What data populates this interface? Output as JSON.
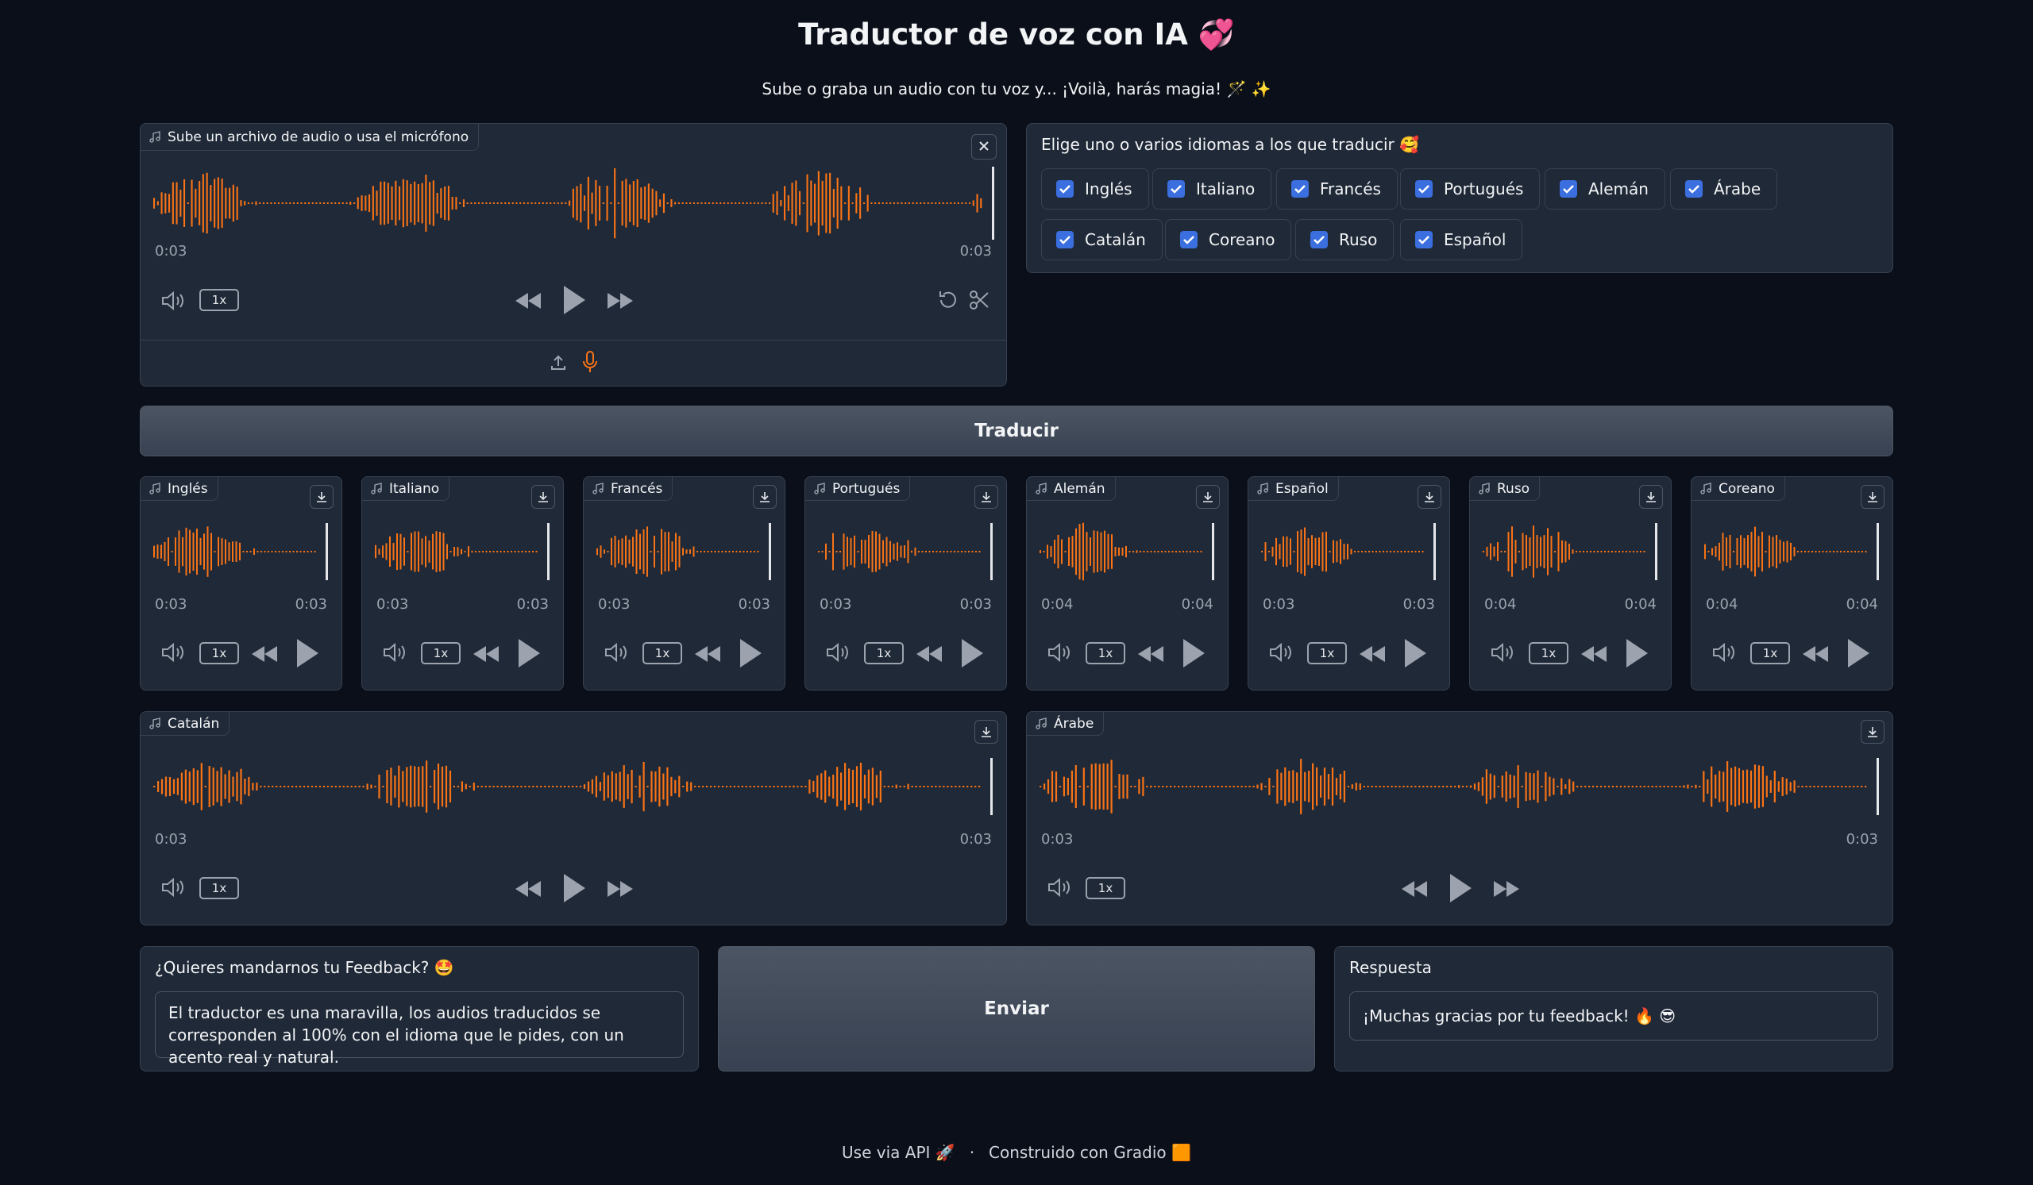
{
  "header": {
    "title": "Traductor de voz con IA 💞",
    "subtitle": "Sube o graba un audio con tu voz y... ¡Voilà, harás magia! 🪄 ✨"
  },
  "input_audio": {
    "label": "Sube un archivo de audio o usa el micrófono",
    "time_current": "0:03",
    "time_total": "0:03",
    "speed": "1x"
  },
  "languages": {
    "label": "Elige uno o varios idiomas a los que traducir 🥰",
    "options": [
      {
        "label": "Inglés",
        "checked": true
      },
      {
        "label": "Italiano",
        "checked": true
      },
      {
        "label": "Francés",
        "checked": true
      },
      {
        "label": "Portugués",
        "checked": true
      },
      {
        "label": "Alemán",
        "checked": true
      },
      {
        "label": "Árabe",
        "checked": true
      },
      {
        "label": "Catalán",
        "checked": true
      },
      {
        "label": "Coreano",
        "checked": true
      },
      {
        "label": "Ruso",
        "checked": true
      },
      {
        "label": "Español",
        "checked": true
      }
    ]
  },
  "translate_button": "Traducir",
  "outputs": [
    {
      "label": "Inglés",
      "time_current": "0:03",
      "time_total": "0:03",
      "speed": "1x"
    },
    {
      "label": "Italiano",
      "time_current": "0:03",
      "time_total": "0:03",
      "speed": "1x"
    },
    {
      "label": "Francés",
      "time_current": "0:03",
      "time_total": "0:03",
      "speed": "1x"
    },
    {
      "label": "Portugués",
      "time_current": "0:03",
      "time_total": "0:03",
      "speed": "1x"
    },
    {
      "label": "Alemán",
      "time_current": "0:04",
      "time_total": "0:04",
      "speed": "1x"
    },
    {
      "label": "Español",
      "time_current": "0:03",
      "time_total": "0:03",
      "speed": "1x"
    },
    {
      "label": "Ruso",
      "time_current": "0:04",
      "time_total": "0:04",
      "speed": "1x"
    },
    {
      "label": "Coreano",
      "time_current": "0:04",
      "time_total": "0:04",
      "speed": "1x"
    }
  ],
  "wide_outputs": [
    {
      "label": "Catalán",
      "time_current": "0:03",
      "time_total": "0:03",
      "speed": "1x"
    },
    {
      "label": "Árabe",
      "time_current": "0:03",
      "time_total": "0:03",
      "speed": "1x"
    }
  ],
  "feedback": {
    "label": "¿Quieres mandarnos tu Feedback? 🤩",
    "value": "El traductor es una maravilla, los audios traducidos se corresponden al 100% con el idioma que le pides,  con un acento real y natural.",
    "submit": "Enviar"
  },
  "response": {
    "label": "Respuesta",
    "value": "¡Muchas gracias por tu feedback! 🔥 😎"
  },
  "footer": {
    "api": "Use via API",
    "api_icon": "🚀",
    "separator": "·",
    "built": "Construido con Gradio",
    "built_icon": "🟧"
  },
  "colors": {
    "background": "#0b0f19",
    "panel": "#1f2937",
    "border": "#374151",
    "waveform": "#f97316",
    "checkbox": "#3b6fe0"
  }
}
